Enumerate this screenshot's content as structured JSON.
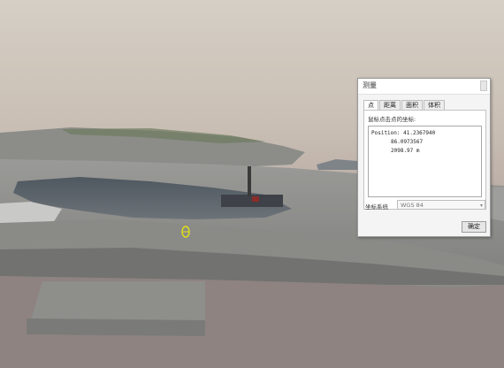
{
  "dialog": {
    "title": "测量",
    "tabs": [
      {
        "label": "点",
        "active": true
      },
      {
        "label": "距离",
        "active": false
      },
      {
        "label": "面积",
        "active": false
      },
      {
        "label": "体积",
        "active": false
      }
    ],
    "panel_label": "鼠标点击点的坐标:",
    "output_lines": [
      "Position: 41.2367940",
      "86.0973567",
      "2098.97 m"
    ],
    "coordinate_system_label": "坐标系统",
    "coordinate_system_value": "WGS 84",
    "ok_label": "确定"
  },
  "colors": {
    "sky_top": "#d3cbc1",
    "sky_bottom": "#a89a95",
    "terrain": "#8f8f8c",
    "marker": "#e0e01a"
  },
  "scene": {
    "marker_icon": "target-circle-icon"
  }
}
